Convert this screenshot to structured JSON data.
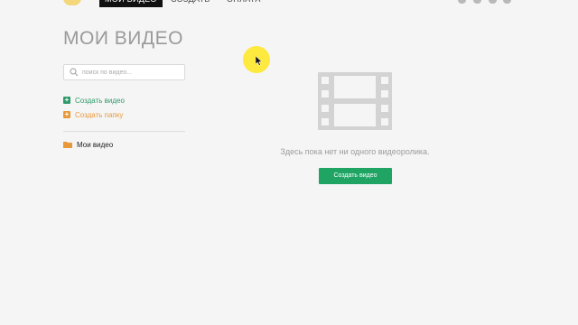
{
  "nav": {
    "tabs": [
      {
        "label": "МОИ ВИДЕО",
        "active": true
      },
      {
        "label": "СОЗДАТЬ",
        "active": false
      },
      {
        "label": "ОПЛАТА",
        "active": false
      }
    ],
    "icons": [
      "settings-icon",
      "bell-icon",
      "gear-icon",
      "logout-icon"
    ]
  },
  "page": {
    "title": "МОИ ВИДЕО"
  },
  "search": {
    "placeholder": "поиск по видео..."
  },
  "sidebar": {
    "create_video": "Создать видео",
    "create_folder": "Создать папку",
    "folder_label": "Мои видео"
  },
  "empty_state": {
    "message": "Здесь пока нет ни одного видеоролика.",
    "button_label": "Создать видео",
    "icon": "film-strip-icon"
  },
  "colors": {
    "accent_green": "#1fa463",
    "link_green": "#2e9a6a",
    "orange": "#e89a3a",
    "cursor_highlight": "#ffe61e"
  }
}
